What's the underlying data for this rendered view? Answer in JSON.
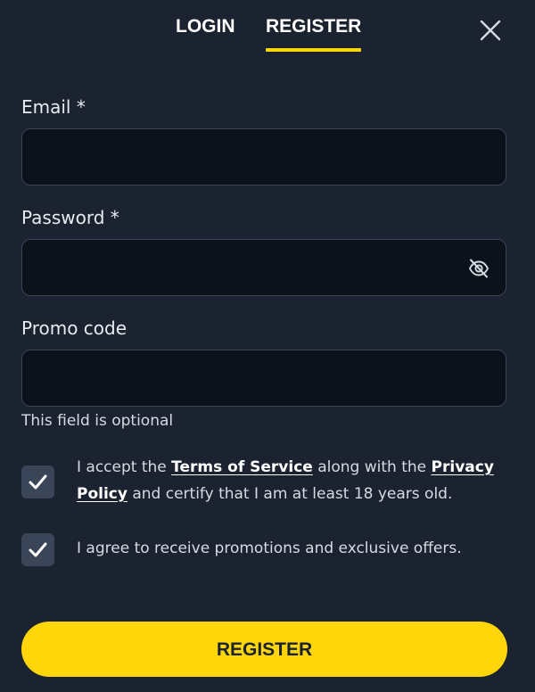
{
  "tabs": {
    "login_label": "LOGIN",
    "register_label": "REGISTER",
    "active": "REGISTER"
  },
  "close_icon": "close-icon",
  "form": {
    "email": {
      "label": "Email *",
      "value": "",
      "placeholder": ""
    },
    "password": {
      "label": "Password *",
      "value": "",
      "placeholder": "",
      "visibility_icon": "eye-slash-icon"
    },
    "promo": {
      "label": "Promo code",
      "value": "",
      "placeholder": "",
      "helper": "This field is optional"
    }
  },
  "consents": {
    "terms": {
      "checked": true,
      "prefix": "I accept the ",
      "terms_link": "Terms of Service",
      "middle": " along with the ",
      "privacy_link": "Privacy Policy",
      "suffix": " and certify that I am at least 18 years old."
    },
    "promotions": {
      "checked": true,
      "text": "I agree to receive promotions and exclusive offers."
    }
  },
  "submit_label": "REGISTER",
  "colors": {
    "background": "#1b2330",
    "input_background": "#0d121a",
    "accent": "#ffd60a",
    "checkbox": "#3a4558"
  }
}
